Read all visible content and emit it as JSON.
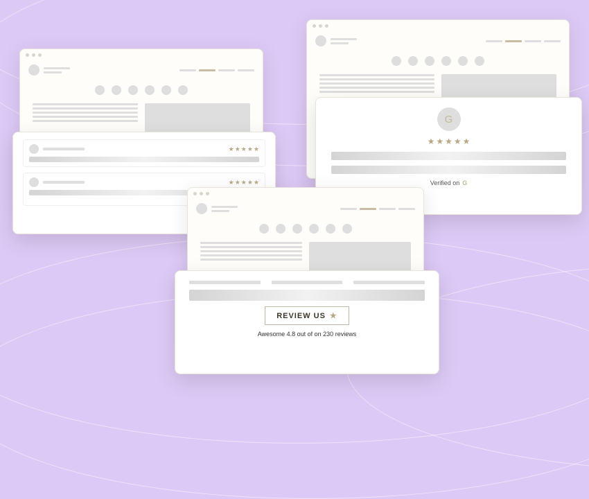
{
  "stars5": [
    "★",
    "★",
    "★",
    "★",
    "★"
  ],
  "verified_text": "Verified on",
  "verified_icon": "G",
  "review_button": "REVIEW US",
  "review_btn_star": "★",
  "subtitle": "Awesome 4.8 out of on 230 reviews",
  "ver_small": "Verified on G"
}
